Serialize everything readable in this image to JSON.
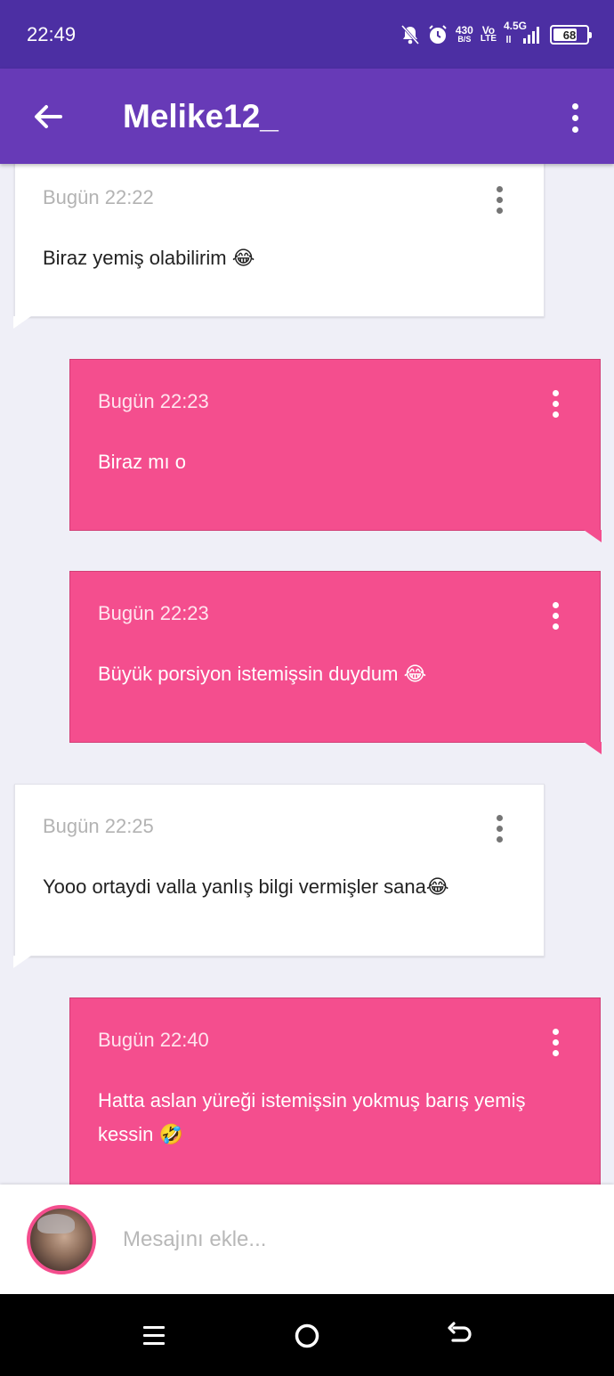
{
  "status_bar": {
    "time": "22:49",
    "net_speed_value": "430",
    "net_speed_unit": "B/S",
    "volte_top": "Vo",
    "volte_bottom": "LTE",
    "network_type": "4.5G",
    "battery": "68",
    "icons": [
      "mute-bell-icon",
      "alarm-icon",
      "signal-icon",
      "battery-icon"
    ]
  },
  "app_bar": {
    "title": "Melike12_",
    "icons": [
      "back-arrow-icon",
      "more-vert-icon"
    ]
  },
  "messages": [
    {
      "direction": "incoming",
      "time": "Bugün 22:22",
      "text": "Biraz yemiş olabilirim 😂"
    },
    {
      "direction": "outgoing",
      "time": "Bugün 22:23",
      "text": "Biraz mı o"
    },
    {
      "direction": "outgoing",
      "time": "Bugün 22:23",
      "text": "Büyük porsiyon istemişsin duydum 😂"
    },
    {
      "direction": "incoming",
      "time": "Bugün 22:25",
      "text": "Yooo ortaydi valla yanlış bilgi vermişler sana😂"
    },
    {
      "direction": "outgoing",
      "time": "Bugün 22:40",
      "text": "Hatta aslan yüreği istemişsin yokmuş barış yemiş kessin 🤣"
    }
  ],
  "composer": {
    "placeholder": "Mesajını ekle..."
  },
  "colors": {
    "status_bar": "#4c2fa3",
    "app_bar": "#673ab7",
    "outgoing_bubble": "#f44e8e",
    "incoming_bubble": "#ffffff",
    "background": "#efeff7"
  },
  "nav_bar": {
    "icons": [
      "recents-menu-icon",
      "home-circle-icon",
      "back-return-icon"
    ]
  }
}
